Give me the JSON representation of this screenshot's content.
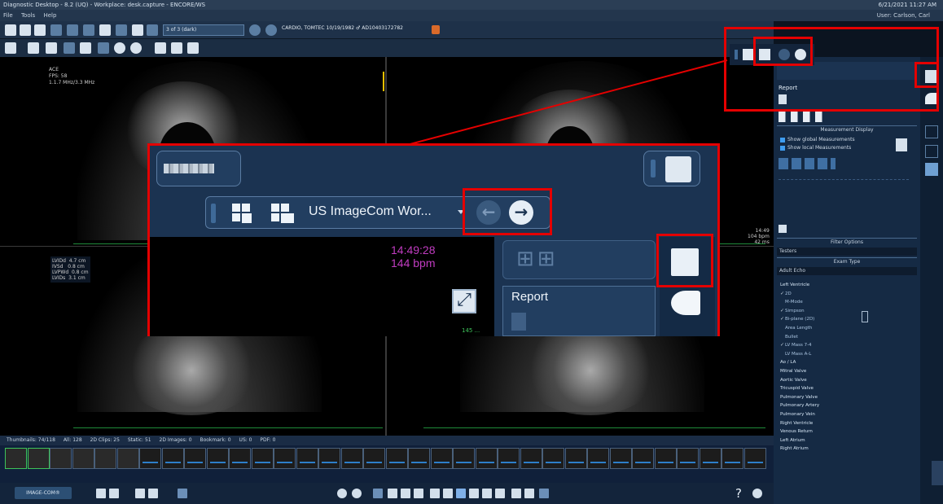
{
  "window": {
    "title": "Diagnostic Desktop - 8.2 (UQ) - Workplace: desk.capture - ENCORE/WS",
    "right_info": "6/21/2021 11:27 AM",
    "user": "User: Carlson, Carl"
  },
  "menu": [
    "File",
    "Tools",
    "Help"
  ],
  "toolbar": {
    "series_combo": "3 of 3 (dark)",
    "patient": "CARDIO, TOMTEC 10/19/1982 ♂ AD10403172782"
  },
  "viewport": {
    "overlay_line1": "ACE",
    "overlay_line2": "FPS: 58",
    "overlay_line3": "1.1.7 MHz/3.3 MHz",
    "overlay_measure": "LVIDd  4.7 cm\nIVSd   0.8 cm\nLVPWd  0.8 cm\nLVIDs  3.1 cm",
    "overlay_right": "14:49\n104 bpm\n42 ms"
  },
  "thumbs": {
    "header": [
      "Thumbnails: 74/118",
      "All: 128",
      "2D Clips: 25",
      "Static: 51",
      "2D Images: 0",
      "Bookmark: 0",
      "US: 0",
      "PDF: 0"
    ],
    "count": 34
  },
  "bottombar": {
    "imagecom_label": "IMAGE-COM®",
    "help": "?"
  },
  "zoom": {
    "workspace_name": "US ImageCom Wor...",
    "time": "14:49:28",
    "bpm": "144 bpm",
    "report_label": "Report",
    "green_text": "145 ...",
    "accent_time_color": "#c03cc0",
    "highlight_color": "#e40000"
  },
  "right_panel": {
    "report_label": "Report",
    "measurement_display": "Measurement Display",
    "show_global": "Show global Measurements",
    "show_local": "Show local Measurements",
    "filter_options": "Filter Options",
    "filter_value": "Testers",
    "exam_type": "Exam Type",
    "exam_value": "Adult Echo",
    "tree": [
      {
        "label": "Left Ventricle",
        "group": true
      },
      {
        "label": "2D",
        "ok": true
      },
      {
        "label": "M-Mode",
        "ok": false
      },
      {
        "label": "Simpson",
        "ok": true
      },
      {
        "label": "Bi-plane (2D)",
        "ok": true
      },
      {
        "label": "Area Length",
        "ok": false
      },
      {
        "label": "Bullet",
        "ok": false
      },
      {
        "label": "LV Mass 7-4",
        "ok": true
      },
      {
        "label": "LV Mass A-L",
        "ok": false
      },
      {
        "label": "Ao / LA",
        "group": true
      },
      {
        "label": "Mitral Valve",
        "group": true
      },
      {
        "label": "Aortic Valve",
        "group": true
      },
      {
        "label": "Tricuspid Valve",
        "group": true
      },
      {
        "label": "Pulmonary Valve",
        "group": true
      },
      {
        "label": "Pulmonary Artery",
        "group": true
      },
      {
        "label": "Pulmonary Vein",
        "group": true
      },
      {
        "label": "Right Ventricle",
        "group": true
      },
      {
        "label": "Venous Return",
        "group": true
      },
      {
        "label": "Left Atrium",
        "group": true
      },
      {
        "label": "Right Atrium",
        "group": true
      }
    ]
  }
}
